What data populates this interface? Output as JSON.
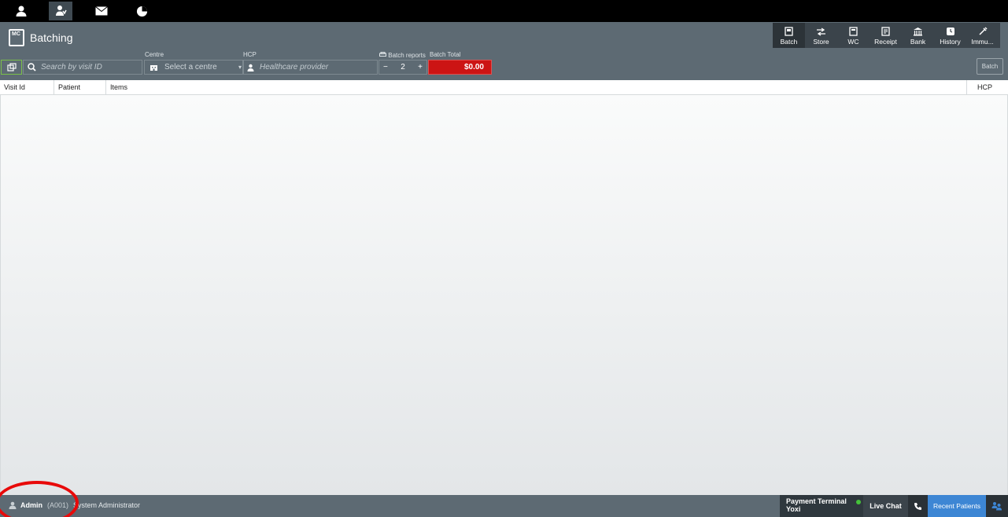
{
  "page": {
    "title": "Batching",
    "icon_text": "MC"
  },
  "topbar": {
    "icons": [
      "person-icon",
      "doctor-icon",
      "mail-icon",
      "pie-chart-icon"
    ],
    "active_index": 1
  },
  "toolbar": {
    "items": [
      {
        "label": "Batch",
        "icon": "batch-icon",
        "active": true
      },
      {
        "label": "Store",
        "icon": "store-icon"
      },
      {
        "label": "WC",
        "icon": "wc-icon"
      },
      {
        "label": "Receipt",
        "icon": "receipt-icon"
      },
      {
        "label": "Bank",
        "icon": "bank-icon"
      },
      {
        "label": "History",
        "icon": "history-icon"
      },
      {
        "label": "Immu...",
        "icon": "syringe-icon"
      }
    ]
  },
  "filters": {
    "search_placeholder": "Search by visit ID",
    "centre_label": "Centre",
    "centre_value": "Select a centre",
    "hcp_label": "HCP",
    "hcp_placeholder": "Healthcare provider",
    "batch_reports_label": "Batch reports",
    "batch_reports_value": "2",
    "minus": "−",
    "plus": "+",
    "batch_total_label": "Batch Total",
    "batch_total_value": "$0.00",
    "batch_button": "Batch"
  },
  "table": {
    "columns": [
      "Visit Id",
      "Patient",
      "Items",
      "HCP"
    ]
  },
  "footer": {
    "user_name": "Admin",
    "user_code": "(A001)",
    "user_role": "System Administrator",
    "payment_terminal_title": "Payment Terminal",
    "payment_terminal_name": "Yoxi",
    "live_chat": "Live Chat",
    "recent_patients": "Recent Patients"
  },
  "colors": {
    "header": "#5d6a73",
    "batch_total": "#cc1414",
    "recent": "#3d86d4",
    "annotation": "#e80a0a"
  }
}
